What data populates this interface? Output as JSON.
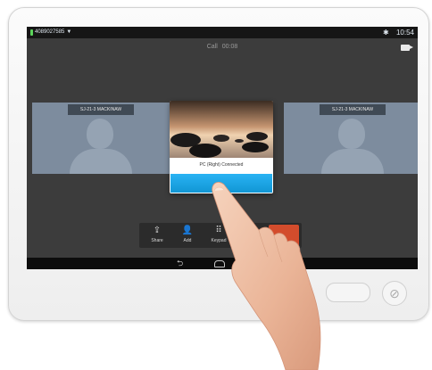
{
  "status_bar": {
    "number": "4089027585",
    "dropdown_glyph": "▼",
    "bluetooth_glyph": "✱",
    "time": "10:54"
  },
  "call": {
    "label": "Call",
    "timer": "00:08"
  },
  "participants": [
    {
      "label": "SJ-21-3 MACKINAW"
    },
    {
      "label": "SJ-21-3 MACKINAW"
    }
  ],
  "modal": {
    "message": "PC (Right) Connected",
    "button_label": ""
  },
  "toolbar": {
    "items": [
      {
        "label": "Share",
        "icon": "share-icon",
        "glyph": "⇪"
      },
      {
        "label": "Add",
        "icon": "add-person-icon",
        "glyph": "👤"
      },
      {
        "label": "Keypad",
        "icon": "keypad-icon",
        "glyph": "⠿"
      },
      {
        "label": "",
        "icon": "pause-icon",
        "glyph": ""
      }
    ]
  },
  "navbar": {
    "back_glyph": "⮌"
  },
  "colors": {
    "accent": "#1ba7ec",
    "end_call": "#d34c2c",
    "tile": "#7d8c9e",
    "screen": "#3c3c3c"
  }
}
